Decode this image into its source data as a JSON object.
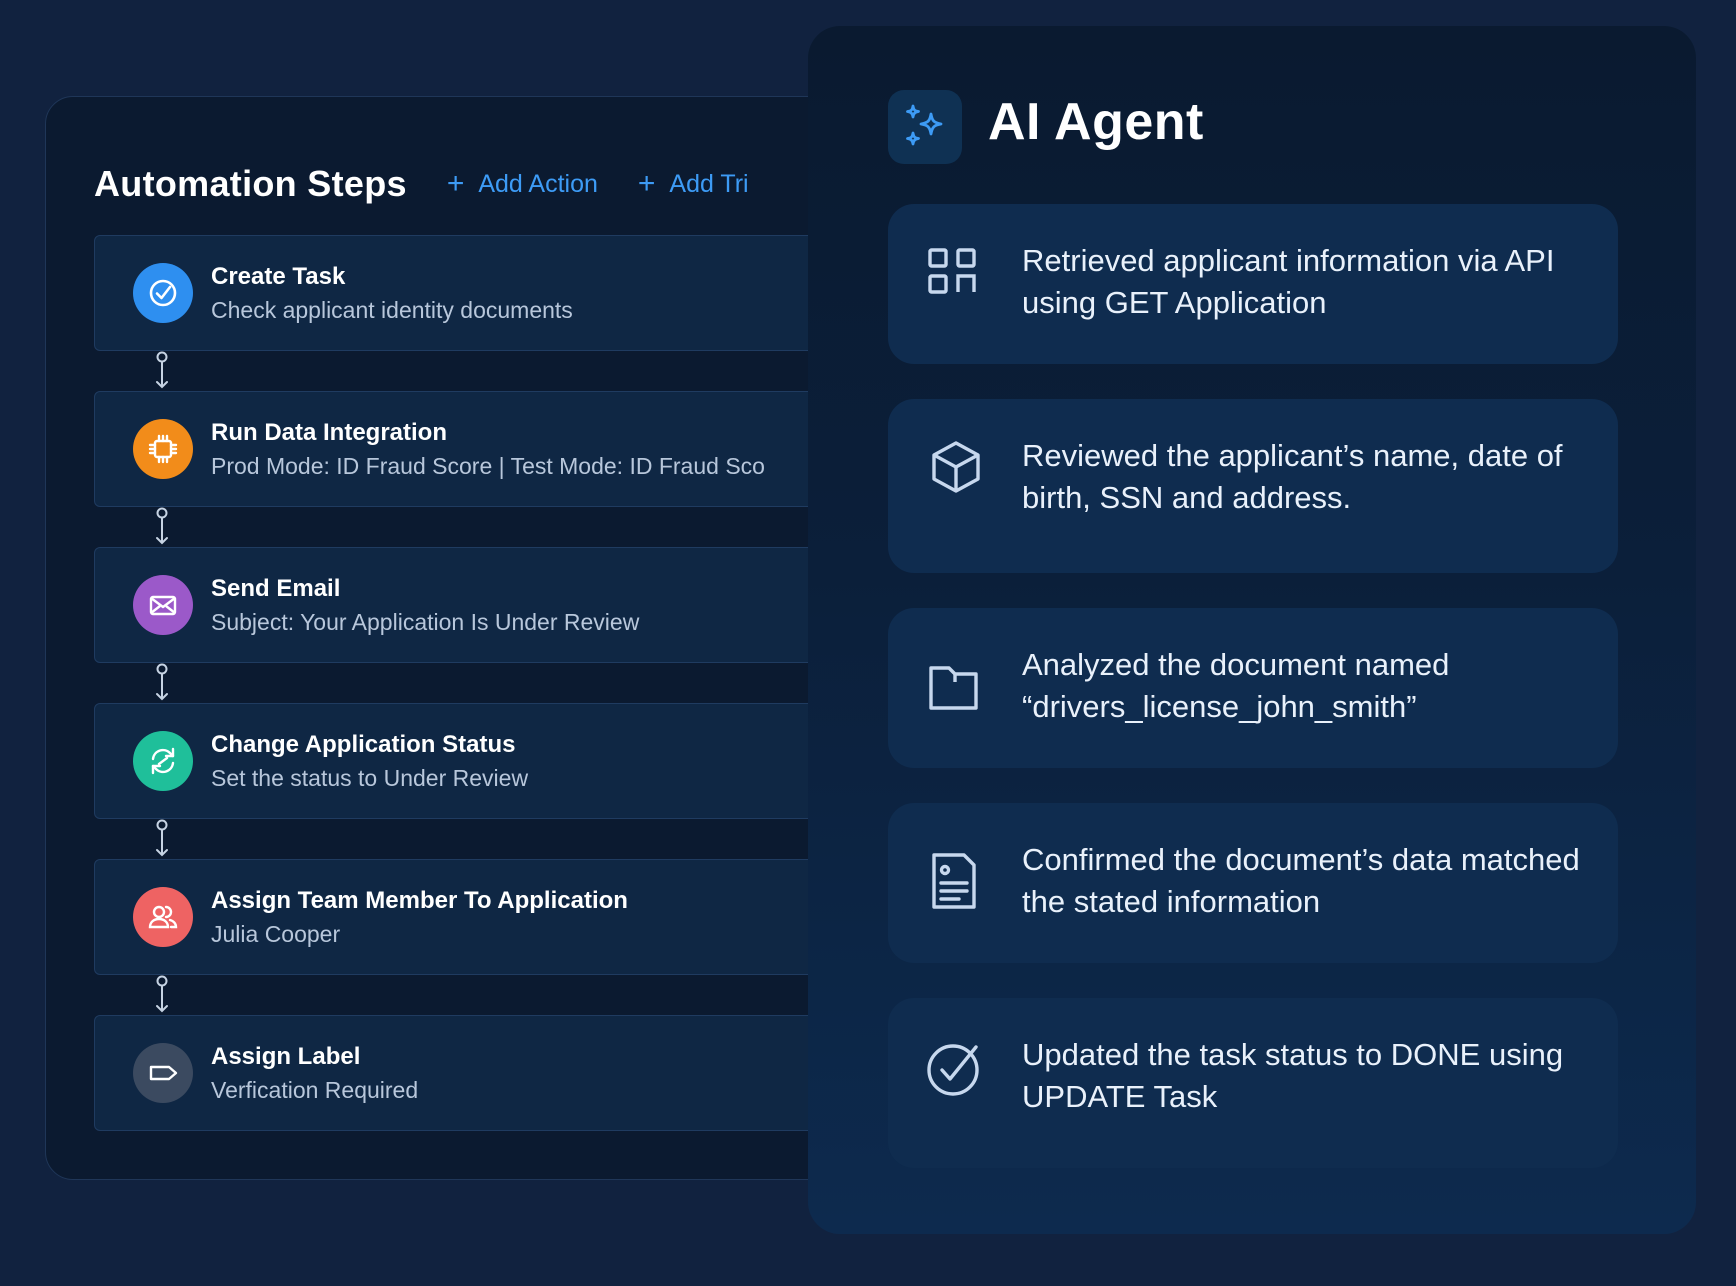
{
  "automation": {
    "title": "Automation Steps",
    "add_action": "Add Action",
    "add_trigger": "Add Tri",
    "steps": [
      {
        "title": "Create Task",
        "subtitle": "Check applicant identity documents",
        "icon": "check-circle-icon",
        "color": "#2e8ff0"
      },
      {
        "title": "Run Data Integration",
        "subtitle": "Prod Mode: ID Fraud Score | Test Mode: ID Fraud Sco",
        "icon": "chip-icon",
        "color": "#f28c1a"
      },
      {
        "title": "Send Email",
        "subtitle": "Subject: Your Application Is Under Review",
        "icon": "envelope-icon",
        "color": "#9b59c9"
      },
      {
        "title": "Change Application Status",
        "subtitle": "Set the status to Under Review",
        "icon": "refresh-icon",
        "color": "#1fbf9a"
      },
      {
        "title": "Assign Team Member To Application",
        "subtitle": "Julia Cooper",
        "icon": "users-icon",
        "color": "#ee6363"
      },
      {
        "title": "Assign Label",
        "subtitle": "Verfication Required",
        "icon": "tag-icon",
        "color": "#3b4a60"
      }
    ]
  },
  "agent": {
    "title": "AI Agent",
    "icon": "sparkles-icon",
    "accent": "#3d9bf5",
    "cards": [
      {
        "text": "Retrieved applicant information via API using GET Application",
        "icon": "grid-icon"
      },
      {
        "text": "Reviewed the applicant’s name, date of birth, SSN and address.",
        "icon": "cube-icon"
      },
      {
        "text": "Analyzed the document named “drivers_license_john_smith”",
        "icon": "folder-icon"
      },
      {
        "text": "Confirmed the document’s data matched the stated information",
        "icon": "document-icon"
      },
      {
        "text": "Updated the task status to DONE using UPDATE Task",
        "icon": "check-circle-icon"
      }
    ]
  }
}
